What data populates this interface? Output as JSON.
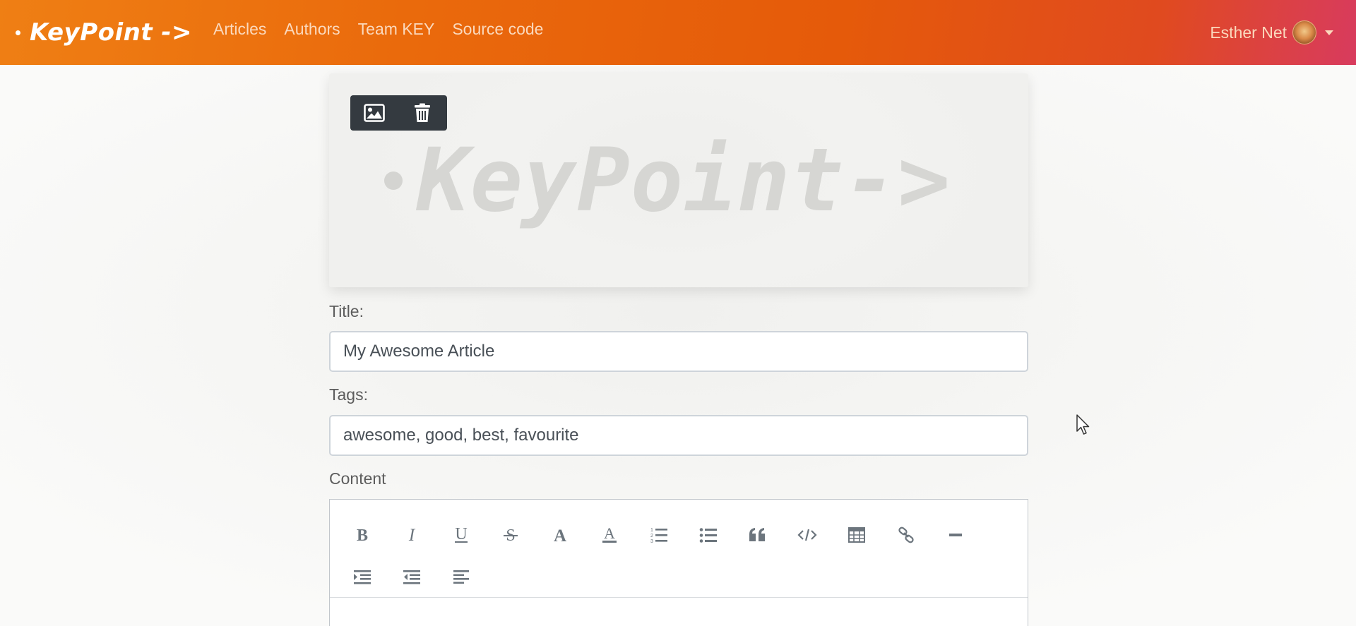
{
  "navbar": {
    "brand": "KeyPoint ->",
    "links": [
      "Articles",
      "Authors",
      "Team KEY",
      "Source code"
    ],
    "user_name": "Esther Net"
  },
  "cover": {
    "placeholder_logo": "KeyPoint->",
    "toolbar_icons": [
      "image-icon",
      "trash-icon"
    ]
  },
  "form": {
    "title_label": "Title:",
    "title_value": "My Awesome Article",
    "tags_label": "Tags:",
    "tags_value": "awesome, good, best, favourite",
    "content_label": "Content"
  },
  "editor": {
    "toolbar_row1": [
      "bold-icon",
      "italic-icon",
      "underline-icon",
      "strikethrough-icon",
      "font-color-icon",
      "highlight-color-icon",
      "ordered-list-icon",
      "unordered-list-icon",
      "blockquote-icon",
      "code-icon",
      "table-icon",
      "link-icon",
      "horizontal-rule-icon"
    ],
    "toolbar_row2": [
      "indent-icon",
      "outdent-icon",
      "align-left-icon"
    ]
  },
  "colors": {
    "navbar_start": "#ef7f14",
    "navbar_end": "#d83b5e",
    "nav_link": "#fbd9bd",
    "toolbar_dark": "#343a40",
    "icon_gray": "#6c757d"
  }
}
